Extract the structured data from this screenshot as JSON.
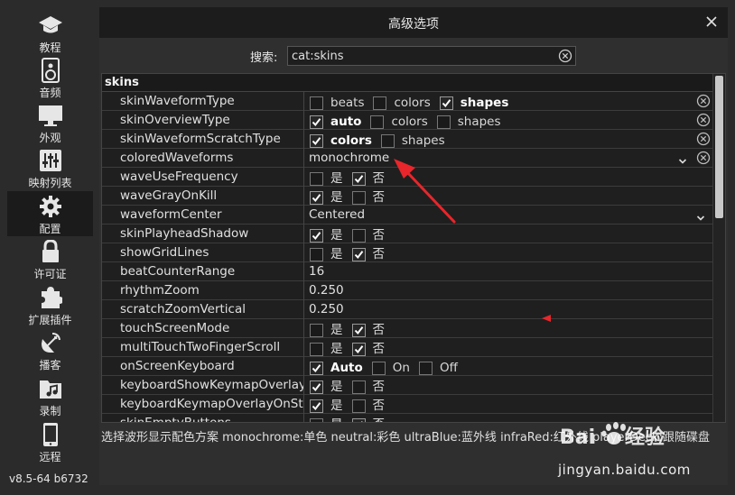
{
  "sidebar": {
    "items": [
      {
        "label": "教程",
        "icon": "graduation-cap-icon"
      },
      {
        "label": "音频",
        "icon": "speaker-icon"
      },
      {
        "label": "外观",
        "icon": "monitor-icon"
      },
      {
        "label": "映射列表",
        "icon": "mixer-sliders-icon"
      },
      {
        "label": "配置",
        "icon": "gear-icon",
        "active": true
      },
      {
        "label": "许可证",
        "icon": "lock-icon"
      },
      {
        "label": "扩展插件",
        "icon": "puzzle-icon"
      },
      {
        "label": "播客",
        "icon": "antenna-icon"
      },
      {
        "label": "录制",
        "icon": "folder-music-icon"
      },
      {
        "label": "远程",
        "icon": "phone-icon"
      }
    ],
    "version": "v8.5-64 b6732"
  },
  "dialog": {
    "title": "高级选项",
    "close_icon": "close-icon"
  },
  "search": {
    "label": "搜索:",
    "value": "cat:skins"
  },
  "table": {
    "group": "skins",
    "yes": "是",
    "no": "否",
    "rows": [
      {
        "key": "skinWaveformType",
        "options": [
          {
            "label": "beats",
            "checked": false
          },
          {
            "label": "colors",
            "checked": false
          },
          {
            "label": "shapes",
            "checked": true
          }
        ],
        "clear": true
      },
      {
        "key": "skinOverviewType",
        "options": [
          {
            "label": "auto",
            "checked": true
          },
          {
            "label": "colors",
            "checked": false
          },
          {
            "label": "shapes",
            "checked": false
          }
        ],
        "clear": true
      },
      {
        "key": "skinWaveformScratchType",
        "options": [
          {
            "label": "colors",
            "checked": true
          },
          {
            "label": "shapes",
            "checked": false
          }
        ],
        "clear": true
      },
      {
        "key": "coloredWaveforms",
        "text": "monochrome",
        "dropdown": true,
        "clear": true
      },
      {
        "key": "waveUseFrequency",
        "yes": false,
        "no": true
      },
      {
        "key": "waveGrayOnKill",
        "yes": true,
        "no": false
      },
      {
        "key": "waveformCenter",
        "text": "Centered",
        "dropdown": true
      },
      {
        "key": "skinPlayheadShadow",
        "yes": true,
        "no": false
      },
      {
        "key": "showGridLines",
        "yes": false,
        "no": true
      },
      {
        "key": "beatCounterRange",
        "text": "16"
      },
      {
        "key": "rhythmZoom",
        "text": "0.250"
      },
      {
        "key": "scratchZoomVertical",
        "text": "0.250"
      },
      {
        "key": "touchScreenMode",
        "yes": false,
        "no": true
      },
      {
        "key": "multiTouchTwoFingerScroll",
        "yes": false,
        "no": true
      },
      {
        "key": "onScreenKeyboard",
        "options": [
          {
            "label": "Auto",
            "checked": true
          },
          {
            "label": "On",
            "checked": false
          },
          {
            "label": "Off",
            "checked": false
          }
        ]
      },
      {
        "key": "keyboardShowKeymapOverlay",
        "yes": true,
        "no": false
      },
      {
        "key": "keyboardKeymapOverlayOnSticky",
        "yes": true,
        "no": false
      },
      {
        "key": "skinEmptyButtons",
        "yes": false,
        "no": true
      }
    ]
  },
  "description": "选择波形显示配色方案 monochrome:单色 neutral:彩色 ultraBlue:蓝外线 infraRed:红外线 playerDeck:跟随碟盘",
  "watermark": {
    "brand": "Baidu经验",
    "text": "jingyan.baidu.com"
  },
  "colors": {
    "accent_red": "#e8262b",
    "background": "#2b2b2b",
    "table_bg": "#1f1f1f"
  }
}
